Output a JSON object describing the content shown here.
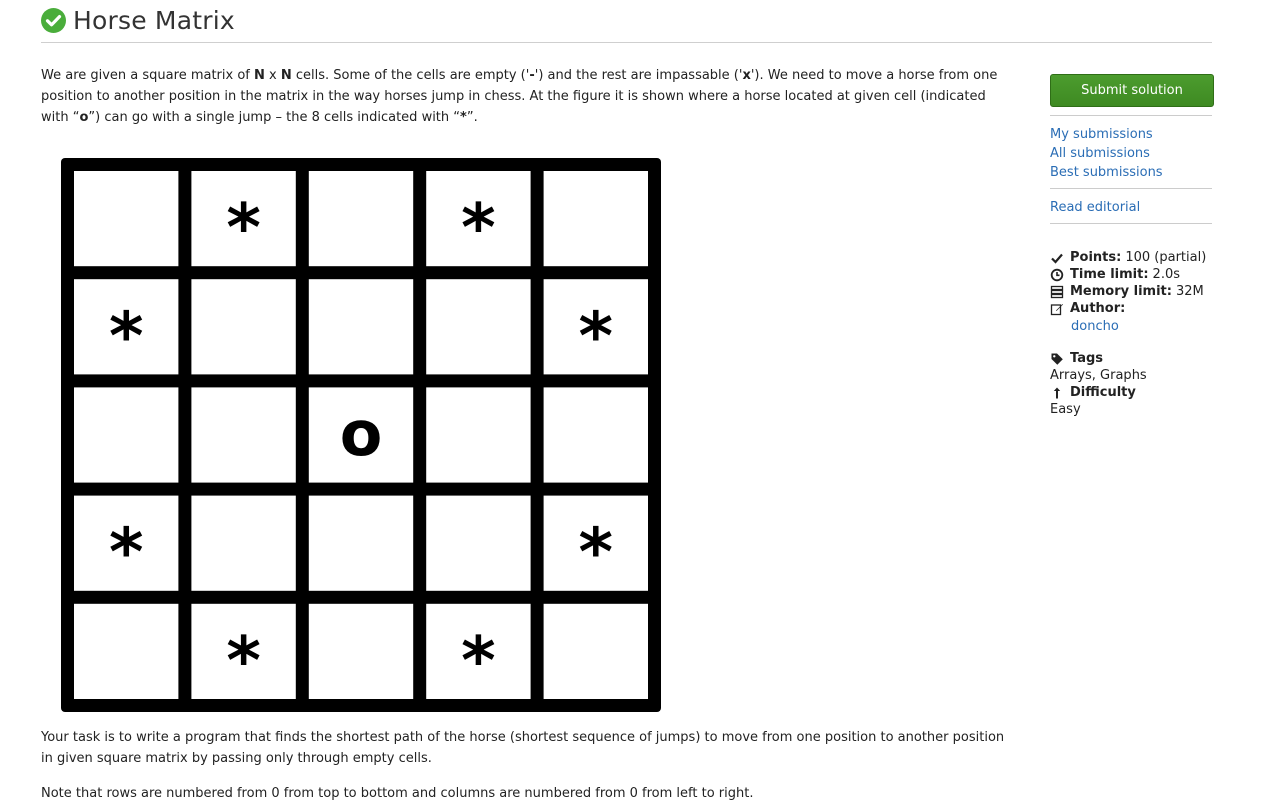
{
  "title": "Horse Matrix",
  "statement": {
    "p1_a": "We are given a square matrix of ",
    "p1_n1": "N",
    "p1_b": " x ",
    "p1_n2": "N",
    "p1_c": " cells. Some of the cells are empty ('",
    "p1_dash": "-",
    "p1_d": "') and the rest are impassable ('",
    "p1_x": "x",
    "p1_e": "'). We need to move a horse from one position to another position in the matrix in the way horses jump in chess. At the figure it is shown where a horse located at given cell (indicated with “",
    "p1_o": "o",
    "p1_f": "”) can go with a single jump – the 8 cells indicated with “",
    "p1_star": "*",
    "p1_g": "”.",
    "p2": "Your task is to write a program that finds the shortest path of the horse (shortest sequence of jumps) to move from one position to another position in given square matrix by passing only through empty cells.",
    "p3": "Note that rows are numbered from 0 from top to bottom and columns are numbered from 0 from left to right."
  },
  "board": {
    "cells": [
      [
        "",
        "*",
        "",
        "*",
        ""
      ],
      [
        "*",
        "",
        "",
        "",
        "*"
      ],
      [
        "",
        "",
        "o",
        "",
        ""
      ],
      [
        "*",
        "",
        "",
        "",
        "*"
      ],
      [
        "",
        "*",
        "",
        "*",
        ""
      ]
    ]
  },
  "sidebar": {
    "submit_label": "Submit solution",
    "links": [
      "My submissions",
      "All submissions",
      "Best submissions"
    ],
    "editorial_label": "Read editorial",
    "points_label": "Points:",
    "points_value": "100 (partial)",
    "time_label": "Time limit:",
    "time_value": "2.0s",
    "memory_label": "Memory limit:",
    "memory_value": "32M",
    "author_label": "Author:",
    "author_value": "doncho",
    "tags_label": "Tags",
    "tags_value": "Arrays, Graphs",
    "difficulty_label": "Difficulty",
    "difficulty_value": "Easy"
  },
  "colors": {
    "accent_green": "#4aad3b",
    "button_green": "#4c9c2e",
    "link_blue": "#2a6db5"
  }
}
